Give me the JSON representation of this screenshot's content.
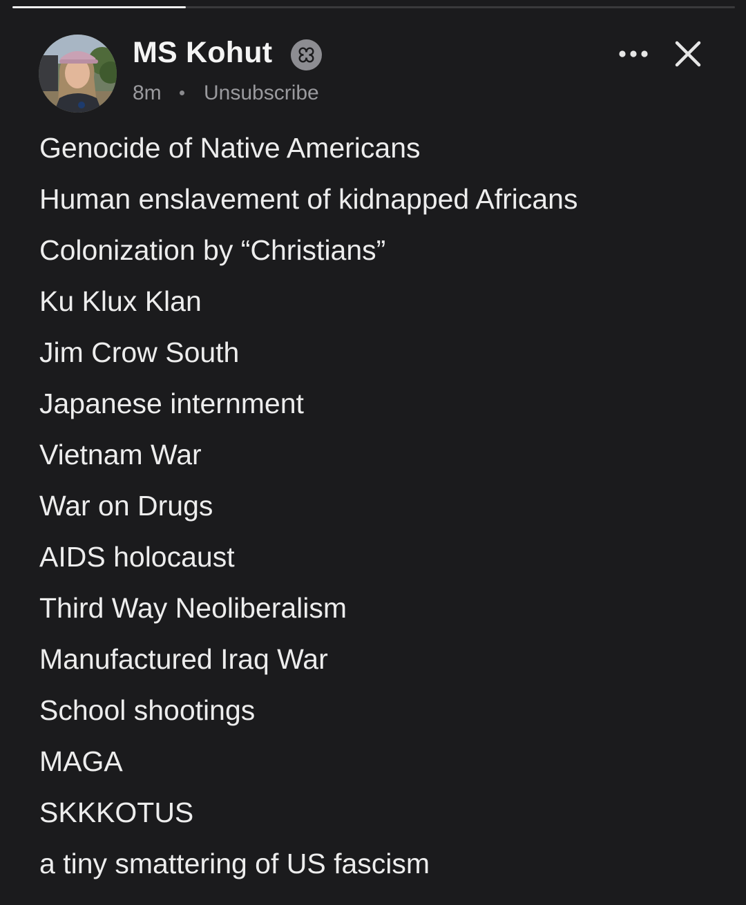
{
  "story_progress": 0.24,
  "author": {
    "name": "MS Kohut",
    "badge_icon": "flower-badge-icon"
  },
  "meta": {
    "time": "8m",
    "unsubscribe_label": "Unsubscribe"
  },
  "actions": {
    "more_icon": "more-horizontal-icon",
    "close_icon": "close-icon"
  },
  "post": {
    "lines": [
      "Genocide of Native Americans",
      "Human enslavement of kidnapped Africans",
      "Colonization by “Christians”",
      "Ku Klux Klan",
      "Jim Crow South",
      "Japanese internment",
      "Vietnam War",
      "War on Drugs",
      "AIDS holocaust",
      "Third Way Neoliberalism",
      "Manufactured Iraq War",
      "School shootings",
      "MAGA",
      "SKKKOTUS",
      "a tiny smattering of US fascism"
    ]
  },
  "colors": {
    "background": "#1b1b1d",
    "text": "#ededed",
    "muted": "#9a9a9e",
    "badge": "#8d8d92"
  }
}
